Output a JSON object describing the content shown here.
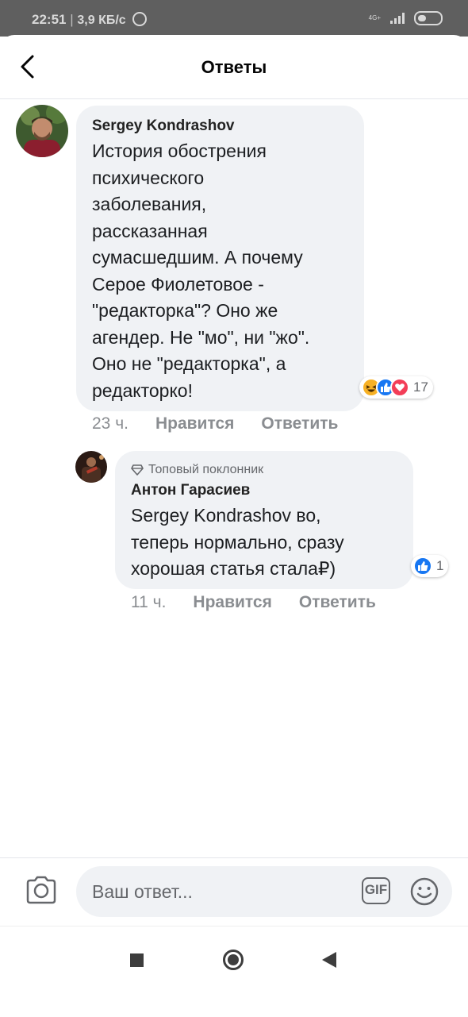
{
  "status_bar": {
    "time": "22:51",
    "separator": "|",
    "speed": "3,9 КБ/с",
    "network": "4G+"
  },
  "header": {
    "title": "Ответы"
  },
  "comment": {
    "author": "Sergey Kondrashov",
    "text_lines": [
      "История обострения",
      "психического",
      "заболевания,",
      "рассказанная",
      "сумасшедшим. А почему",
      "Серое Фиолетовое -",
      "\"редакторка\"? Оно же",
      "агендер. Не \"мо\", ни \"жо\".",
      "Оно не \"редакторка\", а",
      "редакторко!"
    ],
    "reactions": {
      "icons": [
        "haha-icon",
        "like-icon",
        "love-icon"
      ],
      "count": "17"
    },
    "time": "23 ч.",
    "like_label": "Нравится",
    "reply_label": "Ответить"
  },
  "reply": {
    "badge": "Топовый поклонник",
    "author": "Антон Гарасиев",
    "text_lines": [
      "Sergey Kondrashov во,",
      "теперь нормально, сразу",
      "хорошая статья стала₽)"
    ],
    "reactions": {
      "icons": [
        "like-icon"
      ],
      "count": "1"
    },
    "time": "11 ч.",
    "like_label": "Нравится",
    "reply_label": "Ответить"
  },
  "composer": {
    "placeholder": "Ваш ответ...",
    "gif_label": "GIF"
  },
  "colors": {
    "bubble": "#f0f2f5",
    "muted": "#8a8d91",
    "like_blue": "#1877f2",
    "love_red": "#f33e58",
    "haha_yellow": "#f7b125"
  }
}
